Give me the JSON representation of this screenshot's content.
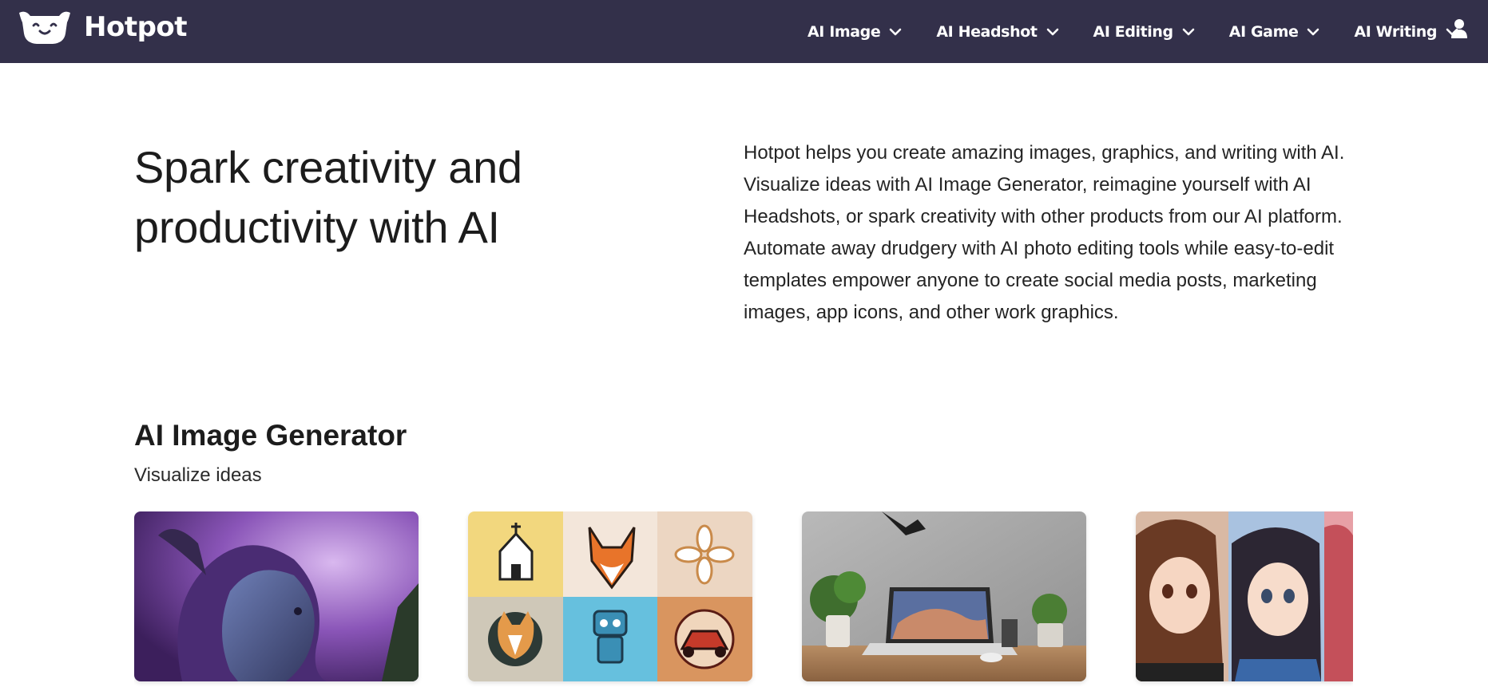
{
  "brand": {
    "name": "Hotpot",
    "logo_icon": "smiling-pot-logo-icon"
  },
  "nav": {
    "items": [
      {
        "label": "AI Image",
        "icon": "chevron-down-icon"
      },
      {
        "label": "AI Headshot",
        "icon": "chevron-down-icon"
      },
      {
        "label": "AI Editing",
        "icon": "chevron-down-icon"
      },
      {
        "label": "AI Game",
        "icon": "chevron-down-icon"
      },
      {
        "label": "AI Writing",
        "icon": "chevron-down-icon"
      }
    ],
    "user_icon": "user-icon"
  },
  "hero": {
    "title": "Spark creativity and productivity with AI",
    "description": "Hotpot helps you create amazing images, graphics, and writing with AI. Visualize ideas with AI Image Generator, reimagine yourself with AI Headshots, or spark creativity with other products from our AI platform. Automate away drudgery with AI photo editing tools while easy-to-edit templates empower anyone to create social media posts, marketing images, app icons, and other work graphics."
  },
  "section": {
    "title": "AI Image Generator",
    "subtitle": "Visualize ideas"
  },
  "colors": {
    "nav_bg": "#33304a",
    "text": "#1f1f1f",
    "page_bg": "#ffffff"
  }
}
